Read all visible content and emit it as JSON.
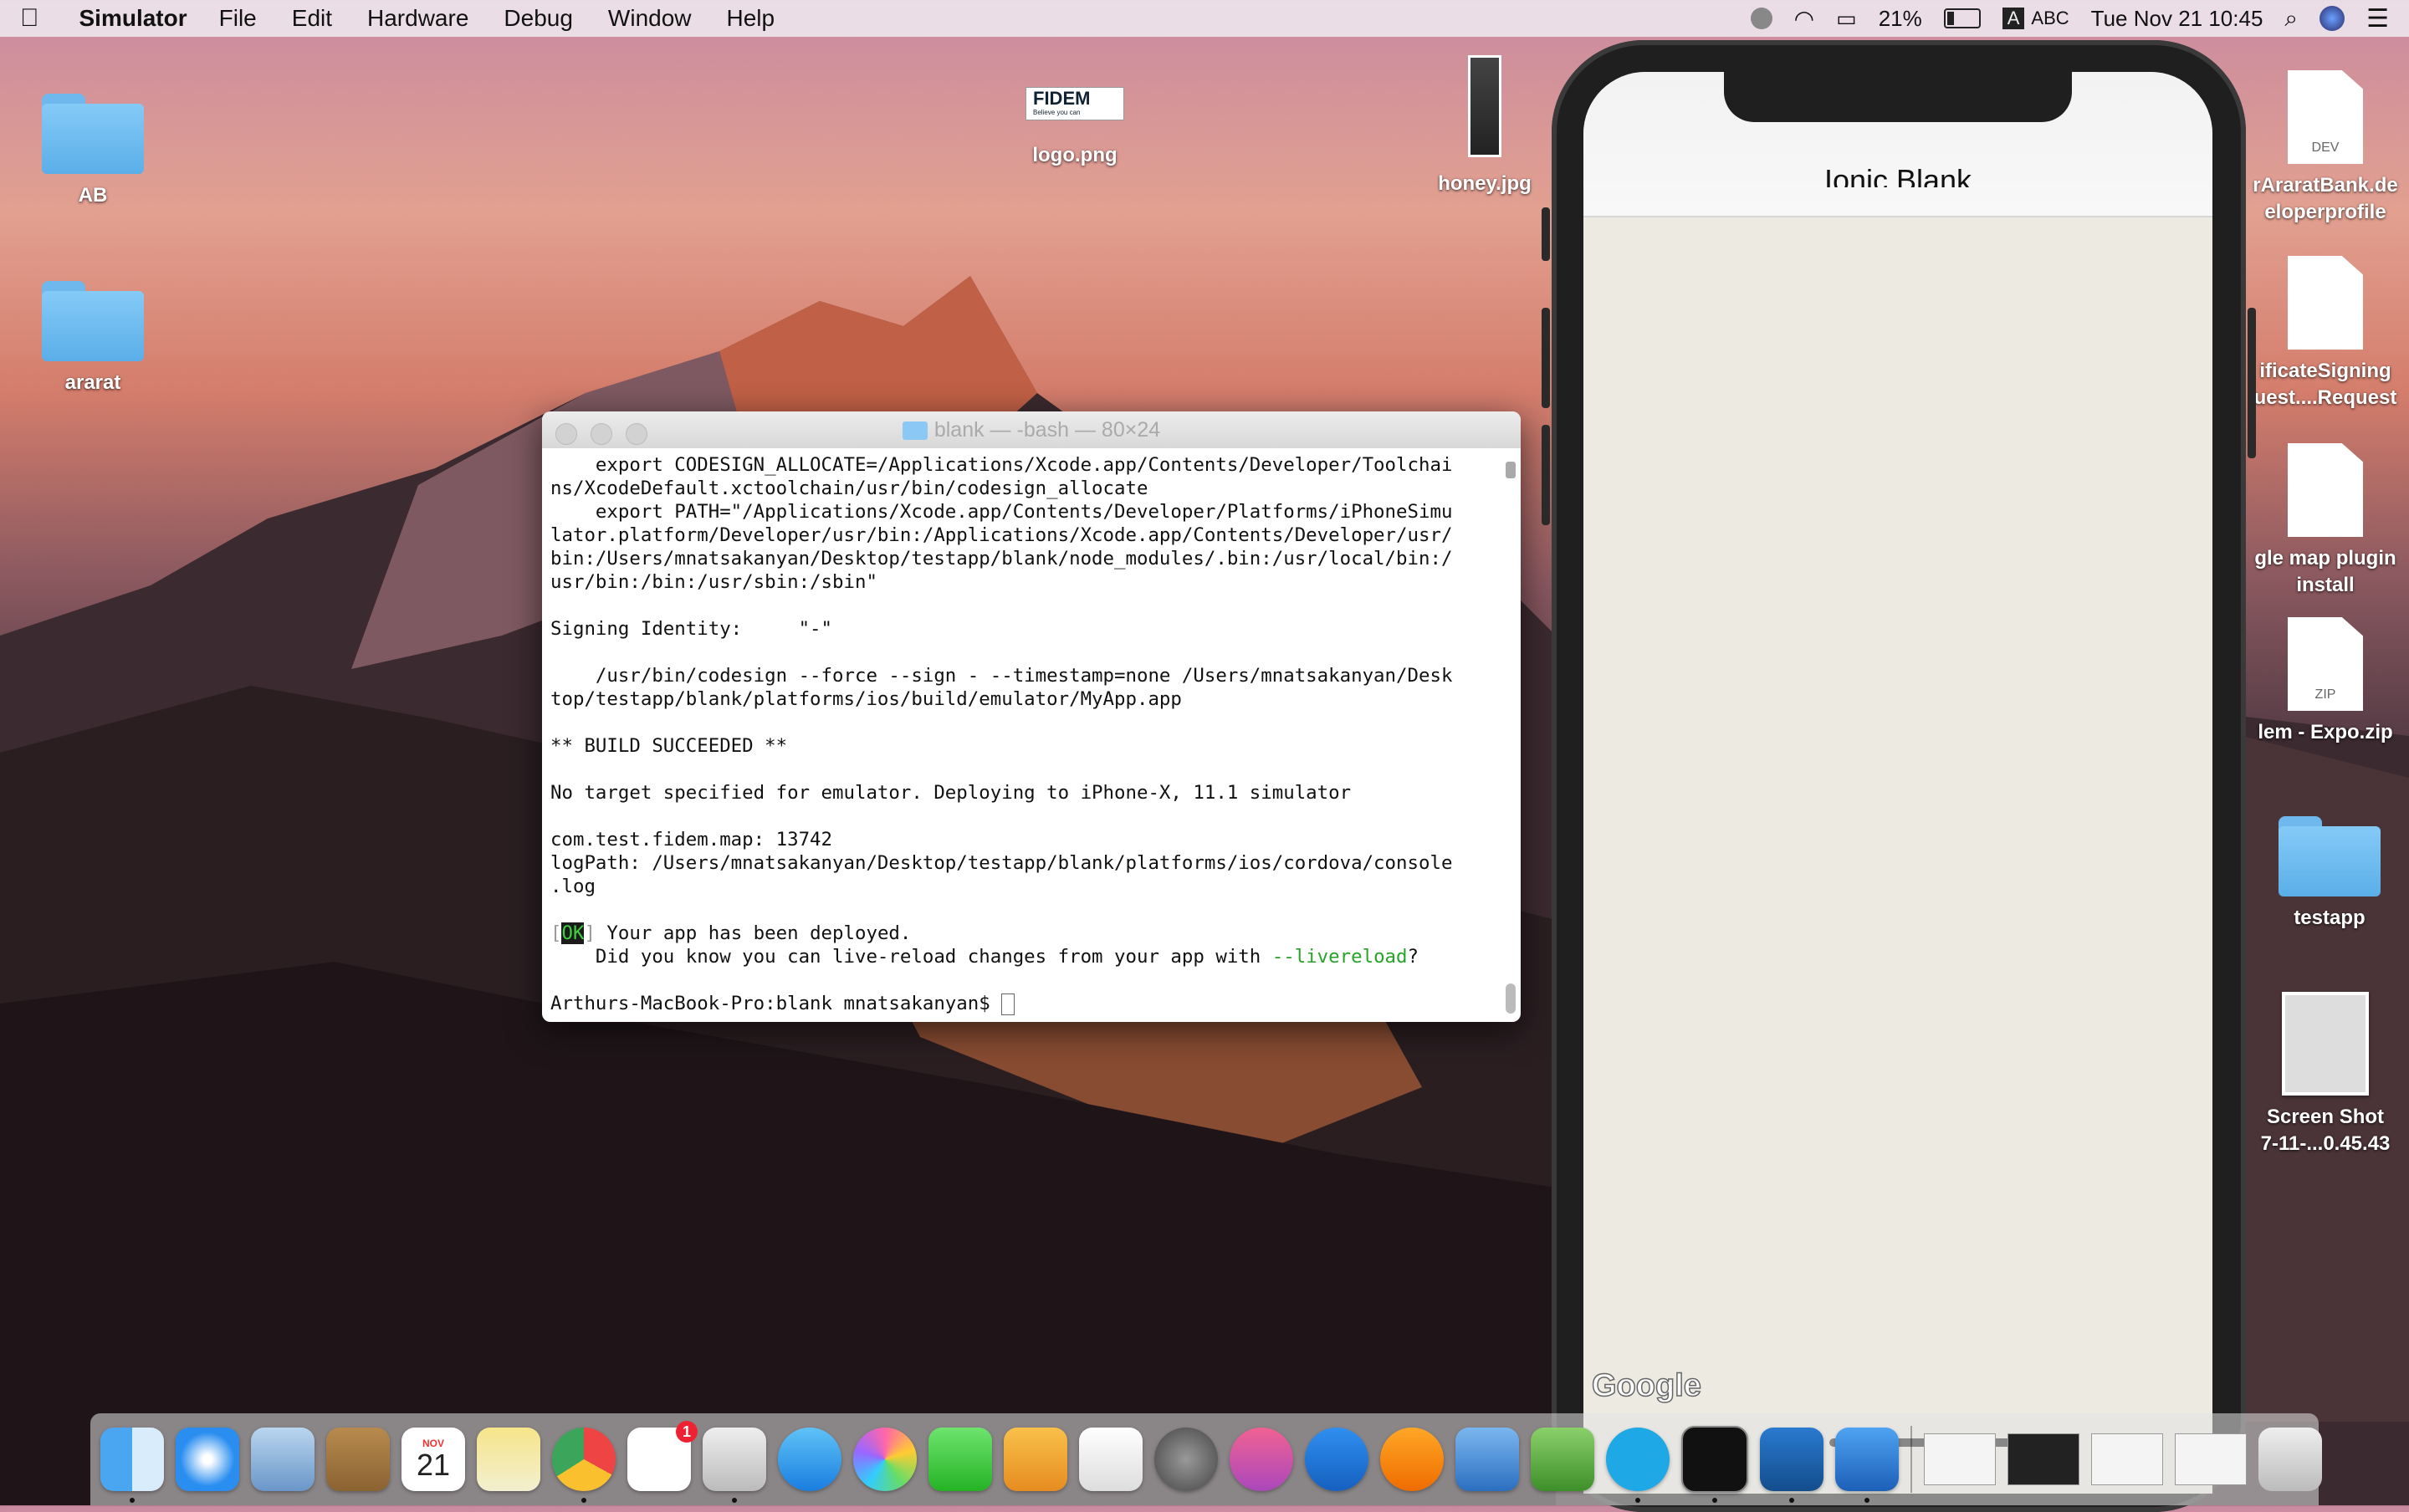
{
  "menubar": {
    "apple": "",
    "app_name": "Simulator",
    "items": [
      "File",
      "Edit",
      "Hardware",
      "Debug",
      "Window",
      "Help"
    ],
    "battery": "21%",
    "input": "ABC",
    "input_badge": "A",
    "clock": "Tue Nov 21  10:45"
  },
  "desktop": {
    "left": [
      {
        "label": "AB",
        "type": "folder"
      },
      {
        "label": "ararat",
        "type": "folder"
      }
    ],
    "top": [
      {
        "label": "logo.png",
        "logo_text": "FIDEM",
        "logo_sub": "Believe you can"
      },
      {
        "label": "honey.jpg"
      }
    ],
    "right": [
      {
        "label": "rAraratBank.de\neloperprofile",
        "tag": "DEV"
      },
      {
        "label": "ificateSigning\nuest....Request",
        "tag": ""
      },
      {
        "label": "gle map plugin\ninstall",
        "tag": ""
      },
      {
        "label": "lem - Expo.zip",
        "tag": "ZIP"
      },
      {
        "label": "testapp",
        "type": "folder"
      },
      {
        "label": "Screen Shot\n7-11-...0.45.43"
      }
    ]
  },
  "terminal": {
    "title": "blank — -bash — 80×24",
    "lines": [
      "    export CODESIGN_ALLOCATE=/Applications/Xcode.app/Contents/Developer/Toolchai",
      "ns/XcodeDefault.xctoolchain/usr/bin/codesign_allocate",
      "    export PATH=\"/Applications/Xcode.app/Contents/Developer/Platforms/iPhoneSimu",
      "lator.platform/Developer/usr/bin:/Applications/Xcode.app/Contents/Developer/usr/",
      "bin:/Users/mnatsakanyan/Desktop/testapp/blank/node_modules/.bin:/usr/local/bin:/",
      "usr/bin:/bin:/usr/sbin:/sbin\"",
      "",
      "Signing Identity:     \"-\"",
      "",
      "    /usr/bin/codesign --force --sign - --timestamp=none /Users/mnatsakanyan/Desk",
      "top/testapp/blank/platforms/ios/build/emulator/MyApp.app",
      "",
      "** BUILD SUCCEEDED **",
      "",
      "No target specified for emulator. Deploying to iPhone-X, 11.1 simulator",
      "",
      "com.test.fidem.map: 13742",
      "logPath: /Users/mnatsakanyan/Desktop/testapp/blank/platforms/ios/cordova/console",
      ".log",
      ""
    ],
    "ok_bracket_open": "[",
    "ok_text": "OK",
    "ok_bracket_close": "]",
    "ok_message": " Your app has been deployed.",
    "hint_prefix": "    Did you know you can live-reload changes from your app with ",
    "hint_flag": "--livereload",
    "hint_suffix": "?",
    "prompt": "Arthurs-MacBook-Pro:blank mnatsakanyan$ "
  },
  "simulator": {
    "nav_title": "Ionic Blank",
    "map_brand": "Google"
  },
  "dock": {
    "calendar_month": "NOV",
    "calendar_day": "21",
    "reminders_badge": "1"
  }
}
